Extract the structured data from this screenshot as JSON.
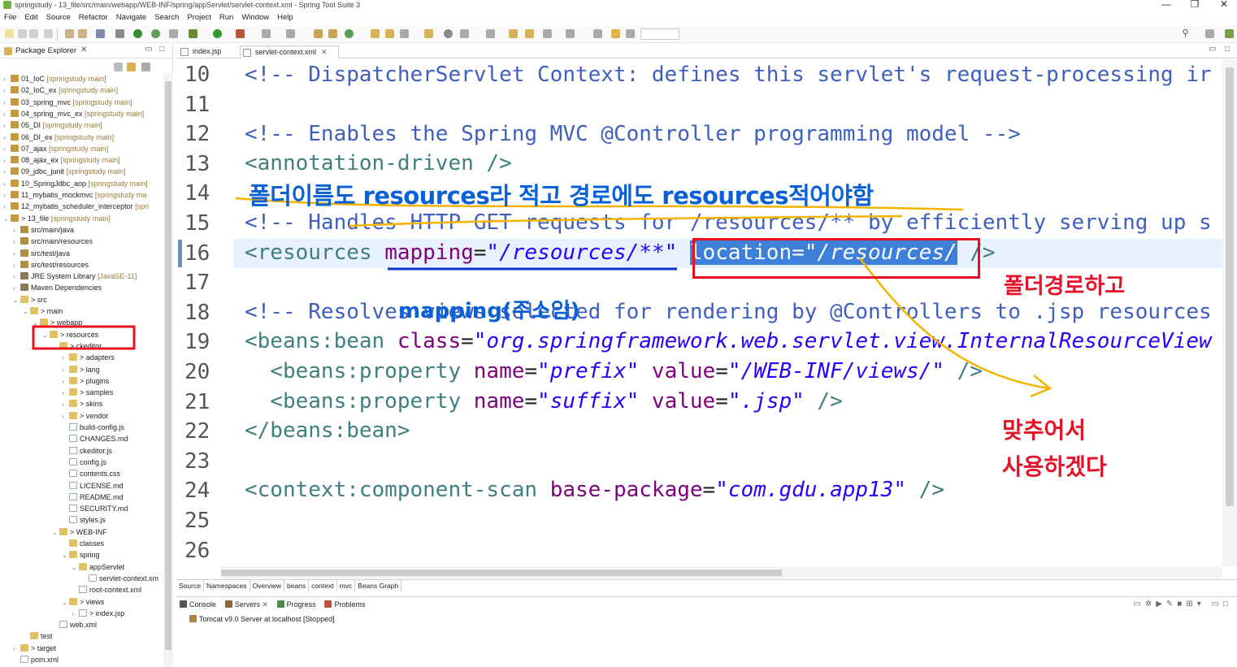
{
  "window": {
    "title": "springstudy - 13_file/src/main/webapp/WEB-INF/spring/appServlet/servlet-context.xml - Spring Tool Suite 3",
    "controls": [
      "—",
      "❐",
      "✕"
    ]
  },
  "menu": [
    "File",
    "Edit",
    "Source",
    "Refactor",
    "Navigate",
    "Search",
    "Project",
    "Run",
    "Window",
    "Help"
  ],
  "package_explorer": {
    "tab_label": "Package Explorer",
    "items": [
      {
        "label": "01_IoC",
        "meta": "[springstudy main]"
      },
      {
        "label": "02_IoC_ex",
        "meta": "[springstudy main]"
      },
      {
        "label": "03_spring_mvc",
        "meta": "[springstudy main]"
      },
      {
        "label": "04_spring_mvc_ex",
        "meta": "[springstudy main]"
      },
      {
        "label": "05_DI",
        "meta": "[springstudy main]"
      },
      {
        "label": "06_DI_ex",
        "meta": "[springstudy main]"
      },
      {
        "label": "07_ajax",
        "meta": "[springstudy main]"
      },
      {
        "label": "08_ajax_ex",
        "meta": "[springstudy main]"
      },
      {
        "label": "09_jdbc_junit",
        "meta": "[springstudy main]"
      },
      {
        "label": "10_SpringJdbc_aop",
        "meta": "[springstudy main]"
      },
      {
        "label": "11_mybatis_mockmvc",
        "meta": "[springstudy ma"
      },
      {
        "label": "12_mybatis_scheduler_interceptor",
        "meta": "[spri"
      },
      {
        "label": "> 13_file",
        "meta": "[springstudy main]"
      },
      {
        "label": "src/main/java",
        "meta": ""
      },
      {
        "label": "src/main/resources",
        "meta": ""
      },
      {
        "label": "src/test/java",
        "meta": ""
      },
      {
        "label": "src/test/resources",
        "meta": ""
      },
      {
        "label": "JRE System Library",
        "meta": "[JavaSE-11]"
      },
      {
        "label": "Maven Dependencies",
        "meta": ""
      },
      {
        "label": "> src",
        "meta": ""
      },
      {
        "label": "> main",
        "meta": ""
      },
      {
        "label": "> webapp",
        "meta": ""
      },
      {
        "label": "> resources",
        "meta": ""
      },
      {
        "label": "> ckeditor",
        "meta": ""
      },
      {
        "label": "> adapters",
        "meta": ""
      },
      {
        "label": "> lang",
        "meta": ""
      },
      {
        "label": "> plugins",
        "meta": ""
      },
      {
        "label": "> samples",
        "meta": ""
      },
      {
        "label": "> skins",
        "meta": ""
      },
      {
        "label": "> vendor",
        "meta": ""
      },
      {
        "label": "build-config.js",
        "meta": ""
      },
      {
        "label": "CHANGES.md",
        "meta": ""
      },
      {
        "label": "ckeditor.js",
        "meta": ""
      },
      {
        "label": "config.js",
        "meta": ""
      },
      {
        "label": "contents.css",
        "meta": ""
      },
      {
        "label": "LICENSE.md",
        "meta": ""
      },
      {
        "label": "README.md",
        "meta": ""
      },
      {
        "label": "SECURITY.md",
        "meta": ""
      },
      {
        "label": "styles.js",
        "meta": ""
      },
      {
        "label": "> WEB-INF",
        "meta": ""
      },
      {
        "label": "classes",
        "meta": ""
      },
      {
        "label": "spring",
        "meta": ""
      },
      {
        "label": "appServlet",
        "meta": ""
      },
      {
        "label": "servlet-context.xm",
        "meta": ""
      },
      {
        "label": "root-context.xml",
        "meta": ""
      },
      {
        "label": "> views",
        "meta": ""
      },
      {
        "label": "> index.jsp",
        "meta": ""
      },
      {
        "label": "web.xml",
        "meta": ""
      },
      {
        "label": "test",
        "meta": ""
      },
      {
        "label": "> target",
        "meta": ""
      },
      {
        "label": "pom.xml",
        "meta": ""
      }
    ]
  },
  "editor": {
    "tabs": [
      {
        "label": "index.jsp",
        "active": false
      },
      {
        "label": "servlet-context.xml",
        "active": true
      }
    ],
    "line_numbers": [
      "10",
      "11",
      "12",
      "13",
      "14",
      "15",
      "16",
      "17",
      "18",
      "19",
      "20",
      "21",
      "22",
      "23",
      "24",
      "25",
      "26"
    ],
    "lines": {
      "l10": "<!-- DispatcherServlet Context: defines this servlet's request-processing ir",
      "l12": "<!-- Enables the Spring MVC @Controller programming model -->",
      "l13": "<annotation-driven />",
      "l15": "<!-- Handles HTTP GET requests for /resources/** by efficiently serving up s",
      "l16_tag": "<resources ",
      "l16_attr1": "mapping",
      "l16_val1": "\"/resources/**\"",
      "l16_attr2": "location=",
      "l16_val2": "\"/resources/",
      "l16_end": " />",
      "l18": "<!-- Resolves views selected for rendering by @Controllers to .jsp resources",
      "l19_tag": "<beans:bean ",
      "l19_attr": "class",
      "l19_val": "\"org.springframework.web.servlet.view.InternalResourceView",
      "l20_tag": "  <beans:property ",
      "l20_attr1": "name",
      "l20_val1": "\"prefix\"",
      "l20_attr2": " value",
      "l20_val2": "\"/WEB-INF/views/\"",
      "l20_end": " />",
      "l21_tag": "  <beans:property ",
      "l21_attr1": "name",
      "l21_val1": "\"suffix\"",
      "l21_attr2": " value",
      "l21_val2": "\".jsp\"",
      "l21_end": " />",
      "l22": "</beans:bean>",
      "l24_tag": "<context:component-scan ",
      "l24_attr": "base-package",
      "l24_val": "\"com.gdu.app13\"",
      "l24_end": " />"
    },
    "bottom_tabs": [
      "Source",
      "Namespaces",
      "Overview",
      "beans",
      "context",
      "mvc",
      "Beans Graph"
    ]
  },
  "console": {
    "tabs": [
      "Console",
      "Servers",
      "Progress",
      "Problems"
    ],
    "server_entry": "Tomcat v9.0 Server at localhost  [Stopped]"
  },
  "annotations": {
    "blue_note": "폴더이름도 resources라 적고 경로에도 resources적어야함",
    "blue_mapping": "mapping(주소임)",
    "red_folder_path": "폴더경로하고",
    "red_match_1": "맞추어서",
    "red_match_2": "사용하겠다"
  },
  "colors": {
    "comment": "#3f5fbf",
    "tag": "#3f7f7f",
    "attribute": "#7f007f",
    "value": "#2a00ff",
    "annotation_blue": "#0a60d8",
    "annotation_red": "#e5132a",
    "annotation_orange": "#f2b400"
  }
}
